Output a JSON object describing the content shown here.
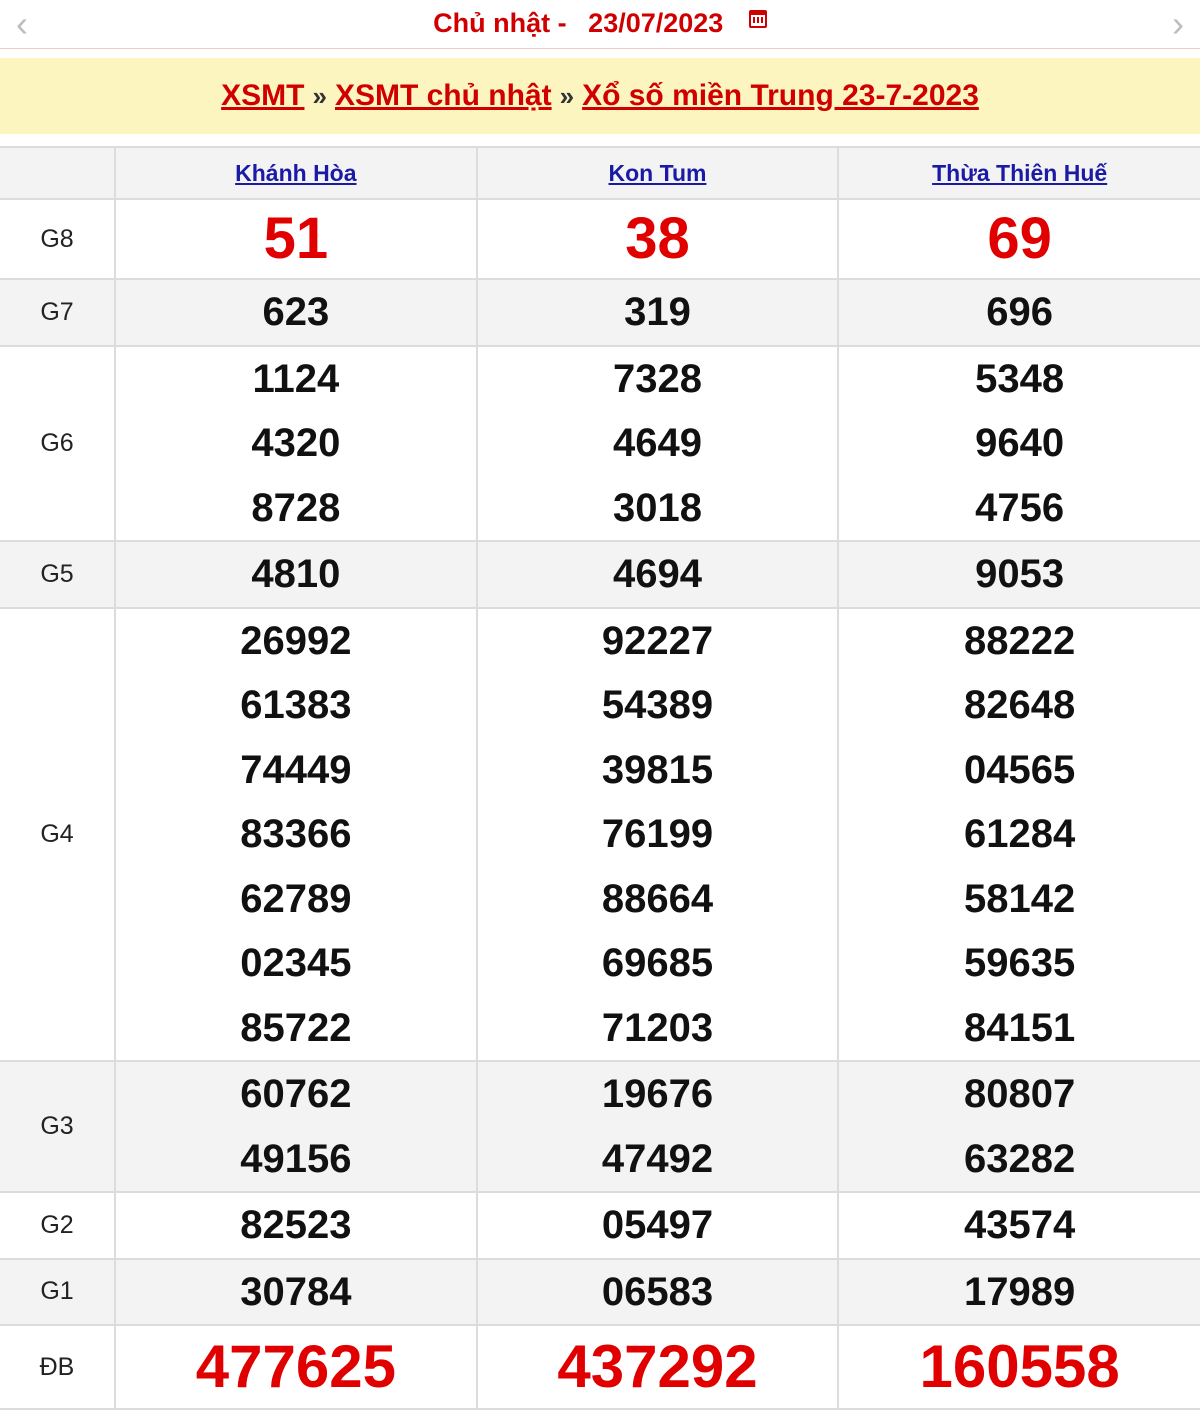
{
  "header": {
    "prev_icon": "‹",
    "next_icon": "›",
    "day": "Chủ nhật -",
    "date": "23/07/2023",
    "calendar_icon": "calendar-icon"
  },
  "breadcrumb": {
    "items": [
      "XSMT",
      "XSMT chủ nhật",
      "Xổ số miền Trung 23-7-2023"
    ],
    "separator": "»"
  },
  "table": {
    "provinces": [
      "Khánh Hòa",
      "Kon Tum",
      "Thừa Thiên Huế"
    ],
    "rows": [
      {
        "label": "G8",
        "values": [
          [
            "51"
          ],
          [
            "38"
          ],
          [
            "69"
          ]
        ]
      },
      {
        "label": "G7",
        "values": [
          [
            "623"
          ],
          [
            "319"
          ],
          [
            "696"
          ]
        ]
      },
      {
        "label": "G6",
        "values": [
          [
            "1124",
            "4320",
            "8728"
          ],
          [
            "7328",
            "4649",
            "3018"
          ],
          [
            "5348",
            "9640",
            "4756"
          ]
        ]
      },
      {
        "label": "G5",
        "values": [
          [
            "4810"
          ],
          [
            "4694"
          ],
          [
            "9053"
          ]
        ]
      },
      {
        "label": "G4",
        "values": [
          [
            "26992",
            "61383",
            "74449",
            "83366",
            "62789",
            "02345",
            "85722"
          ],
          [
            "92227",
            "54389",
            "39815",
            "76199",
            "88664",
            "69685",
            "71203"
          ],
          [
            "88222",
            "82648",
            "04565",
            "61284",
            "58142",
            "59635",
            "84151"
          ]
        ]
      },
      {
        "label": "G3",
        "values": [
          [
            "60762",
            "49156"
          ],
          [
            "19676",
            "47492"
          ],
          [
            "80807",
            "63282"
          ]
        ]
      },
      {
        "label": "G2",
        "values": [
          [
            "82523"
          ],
          [
            "05497"
          ],
          [
            "43574"
          ]
        ]
      },
      {
        "label": "G1",
        "values": [
          [
            "30784"
          ],
          [
            "06583"
          ],
          [
            "17989"
          ]
        ]
      },
      {
        "label": "ĐB",
        "values": [
          [
            "477625"
          ],
          [
            "437292"
          ],
          [
            "160558"
          ]
        ]
      }
    ]
  },
  "colors": {
    "accent_red": "#e00000",
    "link_blue": "#1a1aa6",
    "banner_yellow": "#fcf5bf",
    "shade_gray": "#f3f3f3"
  }
}
